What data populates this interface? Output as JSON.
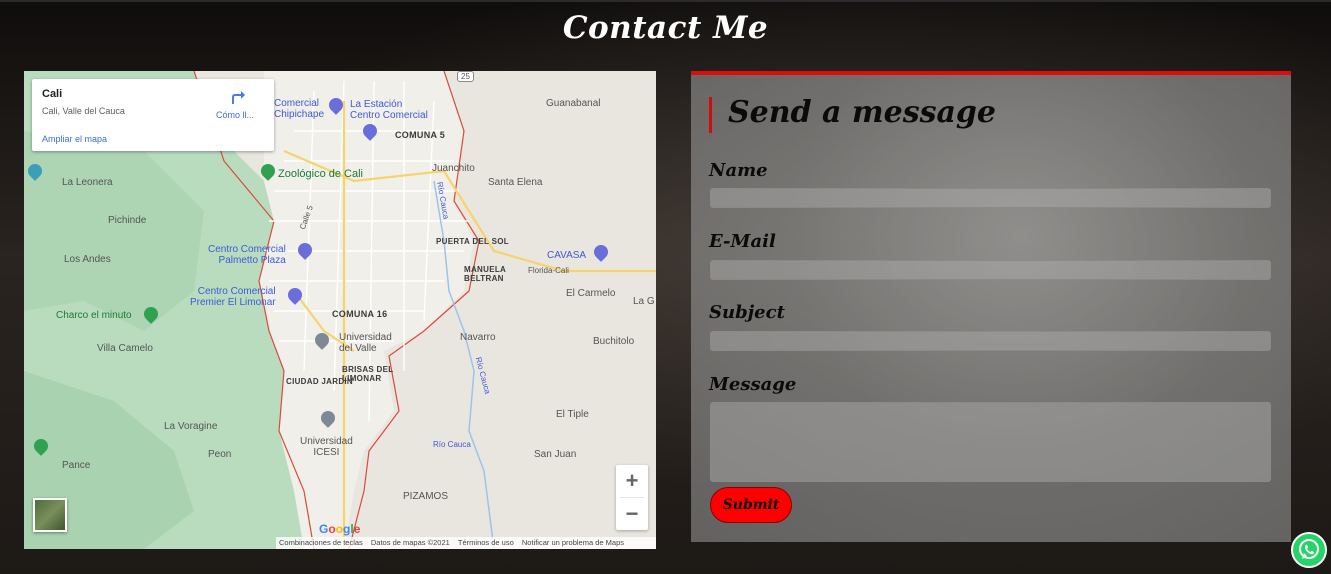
{
  "page": {
    "title": "Contact Me"
  },
  "map": {
    "info": {
      "city": "Cali",
      "address": "Cali, Valle del Cauca",
      "enlarge_link": "Ampliar el mapa",
      "directions_label": "Cómo ll..."
    },
    "labels": {
      "comercial_chipichape": "Comercial\nChipichape",
      "la_estacion": "La Estación\nCentro Comercial",
      "guanabanal": "Guanabanal",
      "comuna5": "COMUNA 5",
      "la_leonera": "La Leonera",
      "zoologico": "Zoológico de Cali",
      "juanchito": "Juanchito",
      "santa_elena": "Santa Elena",
      "pichinde": "Pichinde",
      "calle5": "Calle 5",
      "rio_cauca": "Río Cauca",
      "puerta_del_sol": "PUERTA DEL SOL",
      "cavasa": "CAVASA",
      "los_andes": "Los Andes",
      "palmetto": "Centro Comercial\nPalmetto Plaza",
      "manuela_beltran": "MANUELA\nBELTRAN",
      "florida_cali": "Florida-Cali",
      "premier_limonar": "Centro Comercial\nPremier El Limonar",
      "el_carmelo": "El Carmelo",
      "la_g": "La G",
      "charco": "Charco el minuto",
      "comuna16": "COMUNA 16",
      "univalle": "Universidad\ndel Valle",
      "navarro": "Navarro",
      "buchitolo": "Buchitolo",
      "villa_camelo": "Villa Camelo",
      "brisas": "BRISAS DEL\nLIMONAR",
      "ciudad_jardin": "CIUDAD JARDÍN",
      "rio_cauca2": "Río Cauca",
      "el_tiple": "El Tiple",
      "la_voragine": "La Voragine",
      "icesi": "Universidad\nICESI",
      "rio_cauca3": "Río Cauca",
      "peon": "Peon",
      "san_juan": "San Juan",
      "pance": "Pance",
      "pizamos": "PIZAMOS",
      "route25": "25"
    },
    "zoom_in": "+",
    "zoom_out": "−",
    "google": "Google",
    "attribution": {
      "shortcuts": "Combinaciones de teclas",
      "data": "Datos de mapas ©2021",
      "terms": "Términos de uso",
      "report": "Notificar un problema de Maps"
    }
  },
  "form": {
    "heading": "Send a message",
    "fields": {
      "name_label": "Name",
      "email_label": "E-Mail",
      "subject_label": "Subject",
      "message_label": "Message"
    },
    "values": {
      "name": "",
      "email": "",
      "subject": "",
      "message": ""
    },
    "submit_label": "Submit"
  },
  "colors": {
    "accent": "#e00c0c",
    "submit_bg": "#ff0000",
    "whatsapp": "#25d366"
  }
}
